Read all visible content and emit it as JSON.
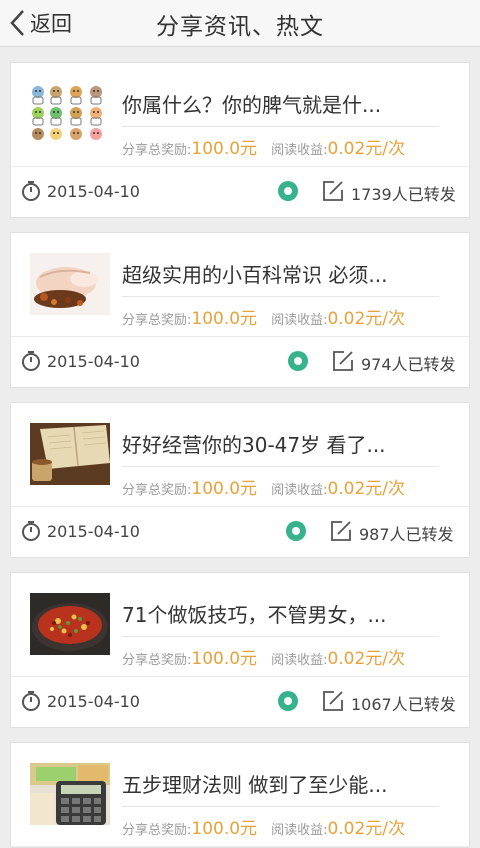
{
  "header": {
    "back_label": "返回",
    "title": "分享资讯、热文"
  },
  "labels": {
    "total_reward": "分享总奖励:",
    "read_income": "阅读收益:"
  },
  "colors": {
    "accent_amount": "#e8a23a",
    "share_icon": "#36b38c",
    "background": "#ededed"
  },
  "articles": [
    {
      "title": "你属什么？你的脾气就是什...",
      "reward": "100.0元",
      "income": "0.02元/次",
      "date": "2015-04-10",
      "shares": "1739人已转发",
      "thumbnail": "zodiac-animals-image"
    },
    {
      "title": "超级实用的小百科常识 必须...",
      "reward": "100.0元",
      "income": "0.02元/次",
      "date": "2015-04-10",
      "shares": "974人已转发",
      "thumbnail": "spa-face-image"
    },
    {
      "title": "好好经营你的30-47岁 看了...",
      "reward": "100.0元",
      "income": "0.02元/次",
      "date": "2015-04-10",
      "shares": "987人已转发",
      "thumbnail": "book-and-tea-image"
    },
    {
      "title": "71个做饭技巧，不管男女，...",
      "reward": "100.0元",
      "income": "0.02元/次",
      "date": "2015-04-10",
      "shares": "1067人已转发",
      "thumbnail": "cooked-dish-image"
    },
    {
      "title": "五步理财法则 做到了至少能...",
      "reward": "100.0元",
      "income": "0.02元/次",
      "date": "",
      "shares": "",
      "thumbnail": "calculator-money-image"
    }
  ]
}
